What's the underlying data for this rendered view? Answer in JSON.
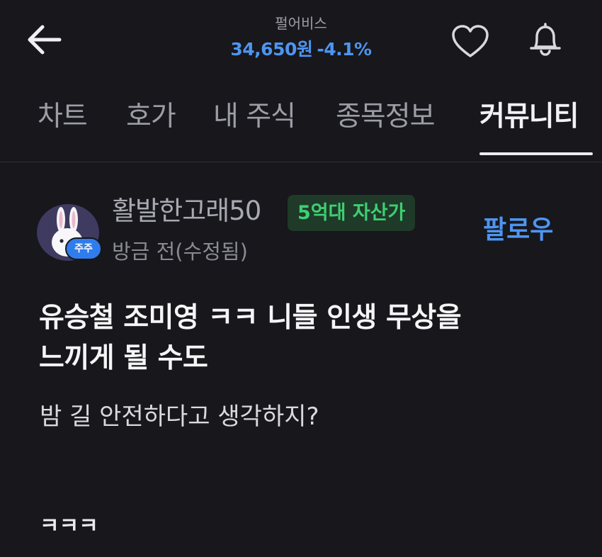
{
  "header": {
    "stock_name": "펄어비스",
    "price": "34,650원",
    "change": "-4.1%",
    "back_icon": "arrow-left-icon",
    "heart_icon": "heart-icon",
    "bell_icon": "bell-icon"
  },
  "tabs": [
    {
      "label": "차트",
      "active": false
    },
    {
      "label": "호가",
      "active": false
    },
    {
      "label": "내 주식",
      "active": false
    },
    {
      "label": "종목정보",
      "active": false
    },
    {
      "label": "커뮤니티",
      "active": true
    }
  ],
  "post": {
    "author": "활발한고래50",
    "asset_badge": "5억대 자산가",
    "avatar_badge": "주주",
    "time": "방금 전(수정됨)",
    "follow": "팔로우",
    "title_line1": "유승철 조미영 ㅋㅋ 니들 인생 무상을",
    "title_line2": "느끼게 될 수도",
    "body": "밤 길 안전하다고 생각하지?",
    "extra": "ㅋㅋㅋ"
  },
  "colors": {
    "background": "#17171c",
    "accent_blue": "#4e95f0",
    "badge_green": "#3ecf72",
    "badge_green_bg": "#1f3a29"
  }
}
